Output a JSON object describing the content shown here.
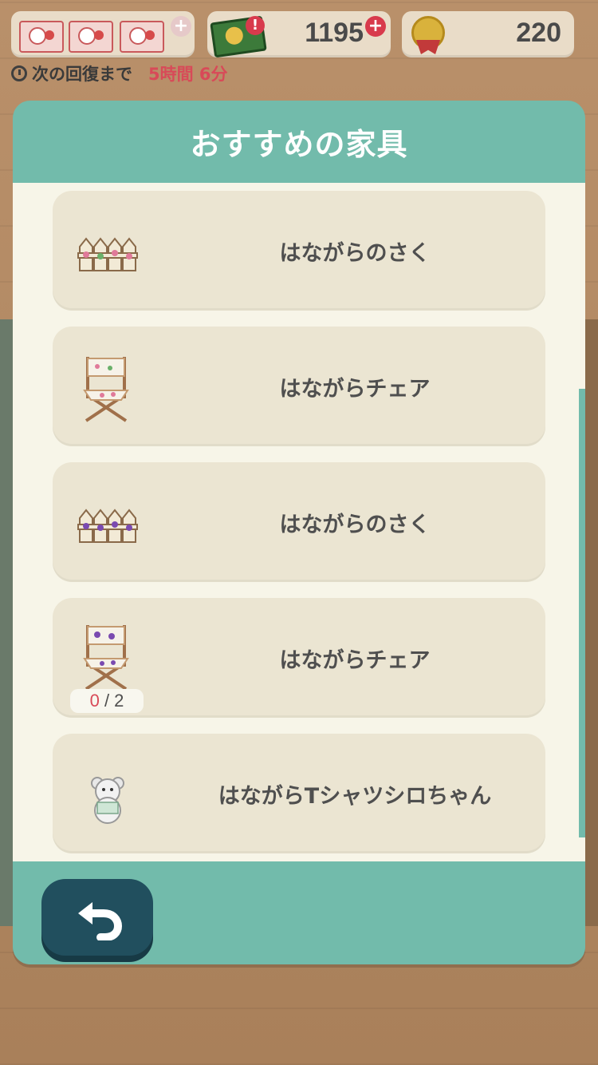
{
  "status": {
    "money": "1195",
    "medals": "220",
    "timer_label": "次の回復まで",
    "timer_value": "5時間 6分"
  },
  "modal": {
    "title": "おすすめの家具",
    "items": [
      {
        "name": "はながらのさく",
        "icon": "fence-icon"
      },
      {
        "name": "はながらチェア",
        "icon": "director-chair-icon"
      },
      {
        "name": "はながらのさく",
        "icon": "fence-icon"
      },
      {
        "name": "はながらチェア",
        "icon": "director-chair-icon",
        "progress_current": "0",
        "progress_total": "2"
      },
      {
        "name": "はながらTシャツシロちゃん",
        "icon": "bear-plush-icon"
      }
    ]
  },
  "footer": {
    "back_icon": "undo-arrow-icon"
  },
  "colors": {
    "header": "#72bbab",
    "back_button": "#214f5e",
    "accent_red": "#d84a58"
  }
}
